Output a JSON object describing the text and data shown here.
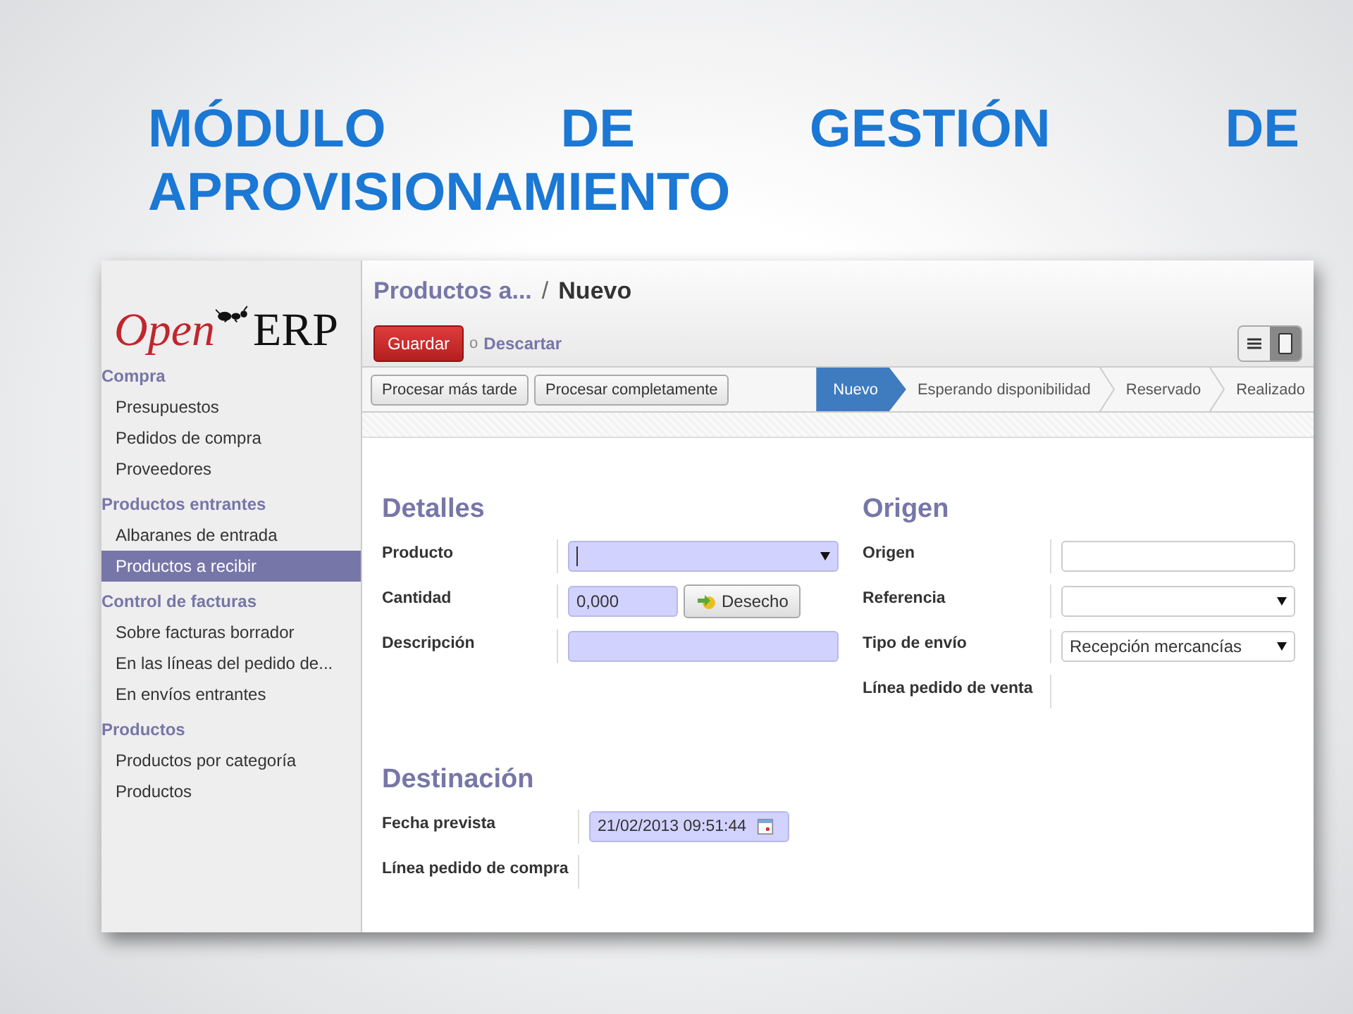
{
  "slide": {
    "title": "MÓDULO DE GESTIÓN DE APROVISIONAMIENTO"
  },
  "logo": {
    "part_1": "Open",
    "part_2": "ERP"
  },
  "sidebar": {
    "sections": [
      {
        "label": "Compra",
        "items": [
          {
            "label": "Presupuestos",
            "selected": false
          },
          {
            "label": "Pedidos de compra",
            "selected": false
          },
          {
            "label": "Proveedores",
            "selected": false
          }
        ]
      },
      {
        "label": "Productos entrantes",
        "items": [
          {
            "label": "Albaranes de entrada",
            "selected": false
          },
          {
            "label": "Productos a recibir",
            "selected": true
          }
        ]
      },
      {
        "label": "Control de facturas",
        "items": [
          {
            "label": "Sobre facturas borrador",
            "selected": false
          },
          {
            "label": "En las líneas del pedido de...",
            "selected": false
          },
          {
            "label": "En envíos entrantes",
            "selected": false
          }
        ]
      },
      {
        "label": "Productos",
        "items": [
          {
            "label": "Productos por categoría",
            "selected": false
          },
          {
            "label": "Productos",
            "selected": false
          }
        ]
      }
    ]
  },
  "breadcrumb": {
    "parent": "Productos a...",
    "separator": "/",
    "current": "Nuevo"
  },
  "actions": {
    "save": "Guardar",
    "or": "o",
    "discard": "Descartar"
  },
  "view_switch": [
    {
      "kind": "list",
      "selected": false
    },
    {
      "kind": "form",
      "selected": true
    }
  ],
  "buttons": [
    "Procesar más tarde",
    "Procesar completamente"
  ],
  "status_steps": [
    {
      "label": "Nuevo",
      "selected": true
    },
    {
      "label": "Esperando disponibilidad",
      "selected": false
    },
    {
      "label": "Reservado",
      "selected": false
    },
    {
      "label": "Realizado",
      "selected": false
    }
  ],
  "groups": [
    {
      "title": "Detalles",
      "fields": [
        {
          "label": "Producto",
          "kind": "select",
          "required": true,
          "focused": true
        },
        {
          "label": "Cantidad",
          "kind": "number",
          "required": true,
          "value": "0,000",
          "button": "Desecho"
        },
        {
          "label": "Descripción",
          "kind": "text",
          "required": true
        }
      ]
    },
    {
      "title": "Origen",
      "fields": [
        {
          "label": "Origen",
          "kind": "text",
          "required": false
        },
        {
          "label": "Referencia",
          "kind": "select",
          "required": false
        },
        {
          "label": "Tipo de envío",
          "kind": "select",
          "required": false,
          "value": "Recepción mercancías"
        },
        {
          "label": "Línea pedido de venta",
          "kind": "none"
        }
      ]
    },
    {
      "title": "Destinación",
      "fields": [
        {
          "label": "Fecha prevista",
          "kind": "datetime",
          "required": true,
          "value": "21/02/2013 09:51:44"
        },
        {
          "label": "Línea pedido de compra",
          "kind": "none"
        }
      ]
    }
  ]
}
